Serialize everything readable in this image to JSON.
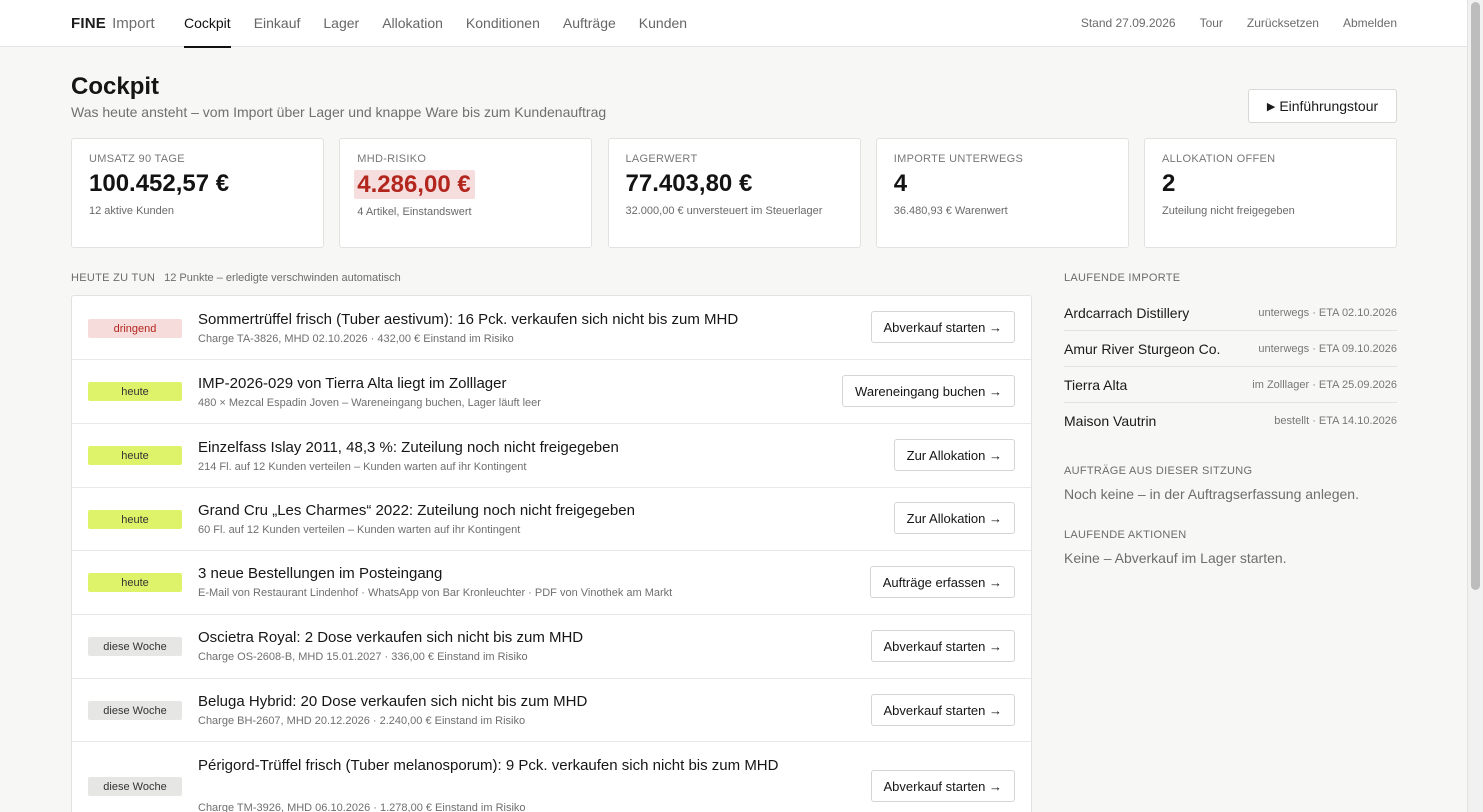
{
  "brand": {
    "strong": "FINE",
    "light": "Import"
  },
  "nav": [
    "Cockpit",
    "Einkauf",
    "Lager",
    "Allokation",
    "Konditionen",
    "Aufträge",
    "Kunden"
  ],
  "top_right": {
    "stand": "Stand 27.09.2026",
    "tour": "Tour",
    "reset": "Zurücksetzen",
    "logout": "Abmelden"
  },
  "header": {
    "title": "Cockpit",
    "subtitle": "Was heute ansteht – vom Import über Lager und knappe Ware bis zum Kundenauftrag",
    "tour_button": "Einführungstour"
  },
  "kpis": [
    {
      "label": "Umsatz 90 Tage",
      "value": "100.452,57 €",
      "note": "12 aktive Kunden"
    },
    {
      "label": "MHD-Risiko",
      "value": "4.286,00 €",
      "note": "4 Artikel, Einstandswert"
    },
    {
      "label": "Lagerwert",
      "value": "77.403,80 €",
      "note": "32.000,00 € unversteuert im Steuerlager"
    },
    {
      "label": "Importe unterwegs",
      "value": "4",
      "note": "36.480,93 € Warenwert"
    },
    {
      "label": "Allokation offen",
      "value": "2",
      "note": "Zuteilung nicht freigegeben"
    }
  ],
  "todo": {
    "caption": "Heute zu tun",
    "hint": "12 Punkte – erledigte verschwinden automatisch",
    "items": [
      {
        "tag": "dringend",
        "title": "Sommertrüffel frisch (Tuber aestivum): 16 Pck. verkaufen sich nicht bis zum MHD",
        "sub": "Charge TA-3826, MHD 02.10.2026 · 432,00 € Einstand im Risiko",
        "button": "Abverkauf starten →"
      },
      {
        "tag": "heute",
        "title": "IMP-2026-029 von Tierra Alta liegt im Zolllager",
        "sub": "480 × Mezcal Espadin Joven – Wareneingang buchen, Lager läuft leer",
        "button": "Wareneingang buchen →"
      },
      {
        "tag": "heute",
        "title": "Einzelfass Islay 2011, 48,3 %: Zuteilung noch nicht freigegeben",
        "sub": "214 Fl. auf 12 Kunden verteilen – Kunden warten auf ihr Kontingent",
        "button": "Zur Allokation →"
      },
      {
        "tag": "heute",
        "title": "Grand Cru „Les Charmes“ 2022: Zuteilung noch nicht freigegeben",
        "sub": "60 Fl. auf 12 Kunden verteilen – Kunden warten auf ihr Kontingent",
        "button": "Zur Allokation →"
      },
      {
        "tag": "heute",
        "title": "3 neue Bestellungen im Posteingang",
        "sub": "E-Mail von Restaurant Lindenhof · WhatsApp von Bar Kronleuchter · PDF von Vinothek am Markt",
        "button": "Aufträge erfassen →"
      },
      {
        "tag": "diese Woche",
        "title": "Oscietra Royal: 2 Dose verkaufen sich nicht bis zum MHD",
        "sub": "Charge OS-2608-B, MHD 15.01.2027 · 336,00 € Einstand im Risiko",
        "button": "Abverkauf starten →"
      },
      {
        "tag": "diese Woche",
        "title": "Beluga Hybrid: 20 Dose verkaufen sich nicht bis zum MHD",
        "sub": "Charge BH-2607, MHD 20.12.2026 · 2.240,00 € Einstand im Risiko",
        "button": "Abverkauf starten →"
      },
      {
        "tag": "diese Woche",
        "title": "Périgord-Trüffel frisch (Tuber melanosporum): 9 Pck. verkaufen sich nicht bis zum MHD",
        "sub": "Charge TM-3926, MHD 06.10.2026 · 1.278,00 € Einstand im Risiko",
        "button": "Abverkauf starten →"
      }
    ]
  },
  "side": {
    "imports_caption": "Laufende Importe",
    "imports": [
      {
        "name": "Ardcarrach Distillery",
        "status": "unterwegs · ETA 02.10.2026"
      },
      {
        "name": "Amur River Sturgeon Co.",
        "status": "unterwegs · ETA 09.10.2026"
      },
      {
        "name": "Tierra Alta",
        "status": "im Zolllager · ETA 25.09.2026"
      },
      {
        "name": "Maison Vautrin",
        "status": "bestellt · ETA 14.10.2026"
      }
    ],
    "orders_caption": "Aufträge aus dieser Sitzung",
    "orders_text": "Noch keine – in der Auftragserfassung anlegen.",
    "actions_caption": "Laufende Aktionen",
    "actions_text": "Keine – Abverkauf im Lager starten."
  }
}
